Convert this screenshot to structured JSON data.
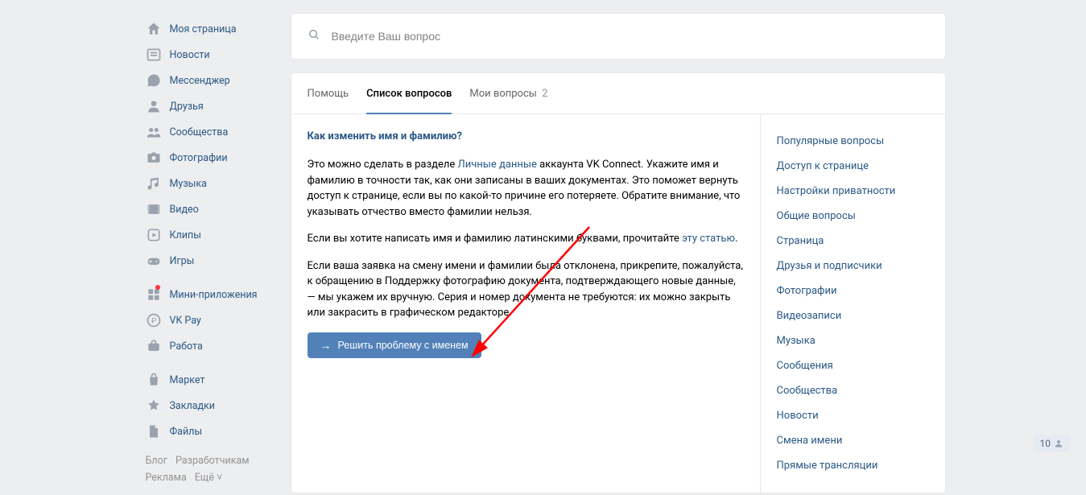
{
  "sidebar": {
    "groups": [
      [
        {
          "icon": "home",
          "label": "Моя страница"
        },
        {
          "icon": "news",
          "label": "Новости"
        },
        {
          "icon": "messenger",
          "label": "Мессенджер"
        },
        {
          "icon": "friends",
          "label": "Друзья"
        },
        {
          "icon": "groups",
          "label": "Сообщества"
        },
        {
          "icon": "photos",
          "label": "Фотографии"
        },
        {
          "icon": "music",
          "label": "Музыка"
        },
        {
          "icon": "video",
          "label": "Видео"
        },
        {
          "icon": "clips",
          "label": "Клипы"
        },
        {
          "icon": "games",
          "label": "Игры"
        }
      ],
      [
        {
          "icon": "miniapps",
          "label": "Мини-приложения",
          "dot": true
        },
        {
          "icon": "vkpay",
          "label": "VK Pay"
        },
        {
          "icon": "jobs",
          "label": "Работа"
        }
      ],
      [
        {
          "icon": "market",
          "label": "Маркет"
        },
        {
          "icon": "bookmarks",
          "label": "Закладки"
        },
        {
          "icon": "files",
          "label": "Файлы"
        }
      ]
    ],
    "footer": [
      "Блог",
      "Разработчикам",
      "Реклама",
      "Ещё"
    ]
  },
  "search": {
    "placeholder": "Введите Ваш вопрос"
  },
  "tabs": [
    {
      "label": "Помощь",
      "active": false
    },
    {
      "label": "Список вопросов",
      "active": true
    },
    {
      "label": "Мои вопросы",
      "count": "2",
      "active": false
    }
  ],
  "article": {
    "title": "Как изменить имя и фамилию?",
    "p1_a": "Это можно сделать в разделе ",
    "p1_link": "Личные данные",
    "p1_b": " аккаунта VK Connect. Укажите имя и фамилию в точности так, как они записаны в ваших документах. Это поможет вернуть доступ к странице, если вы по какой-то причине его потеряете. Обратите внимание, что указывать отчество вместо фамилии нельзя.",
    "p2_a": "Если вы хотите написать имя и фамилию латинскими буквами, прочитайте ",
    "p2_link": "эту статью",
    "p2_b": ".",
    "p3": "Если ваша заявка на смену имени и фамилии была отклонена, прикрепите, пожалуйста, к обращению в Поддержку фотографию документа, подтверждающего новые данные, — мы укажем их вручную. Серия и номер документа не требуются: их можно закрыть или закрасить в графическом редакторе.",
    "button": "Решить проблему с именем"
  },
  "right": [
    "Популярные вопросы",
    "Доступ к странице",
    "Настройки приватности",
    "Общие вопросы",
    "Страница",
    "Друзья и подписчики",
    "Фотографии",
    "Видеозаписи",
    "Музыка",
    "Сообщения",
    "Сообщества",
    "Новости",
    "Смена имени",
    "Прямые трансляции"
  ],
  "badge": {
    "count": "10"
  }
}
